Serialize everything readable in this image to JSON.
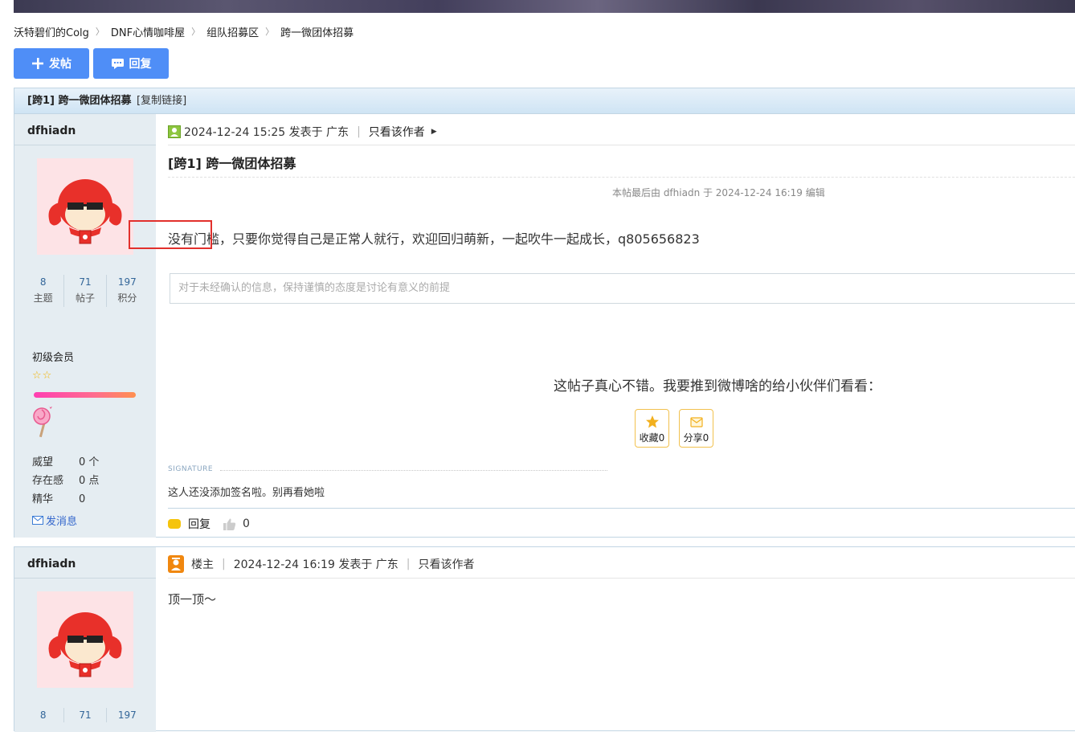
{
  "breadcrumb": [
    "沃特碧们的Colg",
    "DNF心情咖啡屋",
    "组队招募区",
    "跨一微团体招募"
  ],
  "toolbar": {
    "post_label": "发帖",
    "reply_label": "回复"
  },
  "thread": {
    "title": "[跨1] 跨一微团体招募",
    "copy_link": "[复制链接]"
  },
  "post1": {
    "author": "dfhiadn",
    "stats": [
      {
        "num": "8",
        "label": "主题"
      },
      {
        "num": "71",
        "label": "帖子"
      },
      {
        "num": "197",
        "label": "积分"
      }
    ],
    "rank": "初级会员",
    "stars": "☆☆",
    "info": [
      {
        "key": "威望",
        "value": "0 个"
      },
      {
        "key": "存在感",
        "value": "0 点"
      },
      {
        "key": "精华",
        "value": "0"
      }
    ],
    "send_msg": "发消息",
    "datetime": "2024-12-24 15:25 发表于 广东",
    "author_only": "只看该作者",
    "title": "[跨1] 跨一微团体招募",
    "edited": "本帖最后由 dfhiadn 于 2024-12-24 16:19 编辑",
    "content": "没有门槛，只要你觉得自己是正常人就行，欢迎回归萌新，一起吹牛一起成长，q805656823",
    "tip_placeholder": "对于未经确认的信息，保持谨慎的态度是讨论有意义的前提",
    "share_prompt": "这帖子真心不错。我要推到微博啥的给小伙伴们看看：",
    "fav_label": "收藏0",
    "share_label": "分享0",
    "signature_label": "SIGNATURE",
    "signature_text": "这人还没添加签名啦。别再看她啦",
    "reply_label": "回复",
    "like_count": "0"
  },
  "post2": {
    "author": "dfhiadn",
    "stats": [
      {
        "num": "8"
      },
      {
        "num": "71"
      },
      {
        "num": "197"
      }
    ],
    "louzhu": "楼主",
    "datetime": "2024-12-24 16:19 发表于 广东",
    "author_only": "只看该作者",
    "content": "顶一顶～"
  },
  "colors": {
    "accent": "#4f8ef7",
    "sidebar_bg": "#e5edf2",
    "border": "#c2d5e3",
    "highlight": "#e2302c"
  }
}
